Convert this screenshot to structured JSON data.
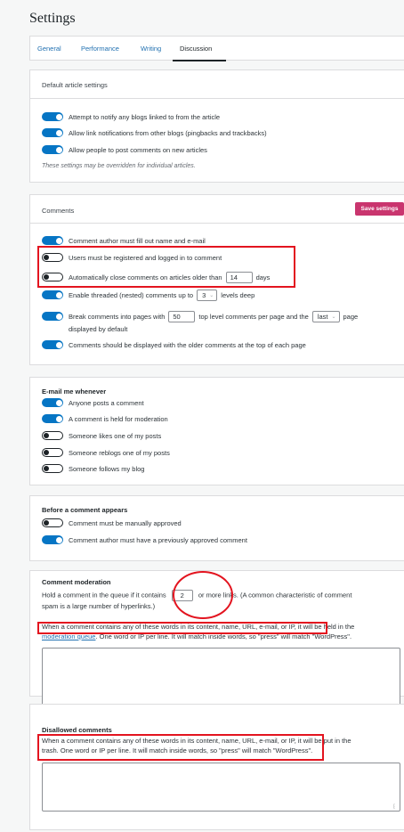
{
  "page": {
    "title": "Settings"
  },
  "tabs": [
    {
      "label": "General",
      "active": false
    },
    {
      "label": "Performance",
      "active": false
    },
    {
      "label": "Writing",
      "active": false
    },
    {
      "label": "Discussion",
      "active": true
    }
  ],
  "default_article": {
    "heading": "Default article settings",
    "items": [
      {
        "label": "Attempt to notify any blogs linked to from the article",
        "on": true
      },
      {
        "label": "Allow link notifications from other blogs (pingbacks and trackbacks)",
        "on": true
      },
      {
        "label": "Allow people to post comments on new articles",
        "on": true
      }
    ],
    "note": "These settings may be overridden for individual articles."
  },
  "comments": {
    "heading": "Comments",
    "save_label": "Save settings",
    "author_info": "Comment author must fill out name and e-mail",
    "registered": "Users must be registered and logged in to comment",
    "close_prefix": "Automatically close comments on articles older than",
    "close_days": "14",
    "close_suffix": "days",
    "threaded_prefix": "Enable threaded (nested) comments up to",
    "threaded_levels": "3",
    "threaded_suffix": "levels deep",
    "paging_prefix": "Break comments into pages with",
    "paging_count": "50",
    "paging_middle": "top level comments per page and the",
    "paging_select": "last",
    "paging_suffix": "page",
    "paging_line2": "displayed by default",
    "order": "Comments should be displayed with the older comments at the top of each page"
  },
  "email": {
    "heading": "E-mail me whenever",
    "items": [
      {
        "label": "Anyone posts a comment",
        "on": true
      },
      {
        "label": "A comment is held for moderation",
        "on": true
      },
      {
        "label": "Someone likes one of my posts",
        "on": false
      },
      {
        "label": "Someone reblogs one of my posts",
        "on": false
      },
      {
        "label": "Someone follows my blog",
        "on": false
      }
    ]
  },
  "before": {
    "heading": "Before a comment appears",
    "items": [
      {
        "label": "Comment must be manually approved",
        "on": false
      },
      {
        "label": "Comment author must have a previously approved comment",
        "on": true
      }
    ]
  },
  "moderation": {
    "heading": "Comment moderation",
    "hold_prefix": "Hold a comment in the queue if it contains",
    "hold_links": "2",
    "hold_suffix": "or more links. (A common characteristic of comment",
    "hold_line2": "spam is a large number of hyperlinks.)",
    "words_line1": "When a comment contains any of these words in its content, name, URL, e-mail, or IP, it will be held in the",
    "words_link": "moderation queue",
    "words_line2_rest": ". One word or IP per line. It will match inside words, so \"press\" will match \"WordPress\"."
  },
  "disallowed": {
    "heading": "Disallowed comments",
    "line1": "When a comment contains any of these words in its content, name, URL, e-mail, or IP, it will be put in the",
    "line2": "trash. One word or IP per line. It will match inside words, so \"press\" will match \"WordPress\"."
  },
  "colors": {
    "accent": "#0675c4",
    "save_button": "#c9356e",
    "highlight": "#e3141f"
  }
}
